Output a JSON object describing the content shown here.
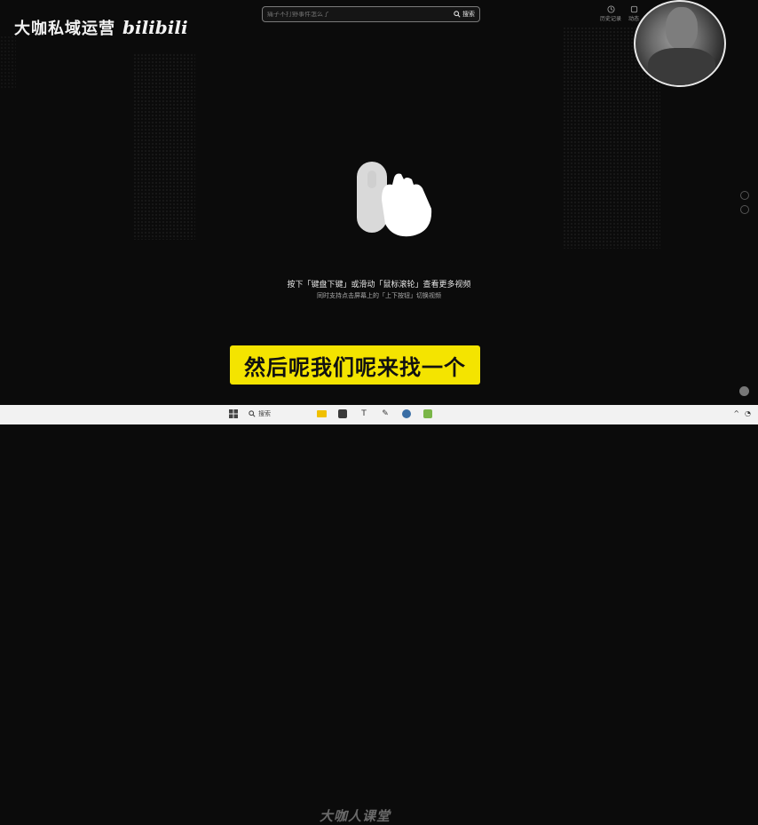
{
  "header": {
    "brand_text": "大咖私域运营",
    "logo_text": "bilibili"
  },
  "search": {
    "placeholder": "痛子不打野事件怎么了",
    "button_label": "搜索"
  },
  "top_icons": [
    {
      "icon": "history-icon",
      "label": "历史记录"
    },
    {
      "icon": "dynamic-icon",
      "label": "动态"
    }
  ],
  "main": {
    "hint_primary": "按下「键盘下键」或滑动「鼠标滚轮」查看更多视频",
    "hint_secondary": "同时支持点击屏幕上的「上下按钮」切换视频"
  },
  "subtitle": "然后呢我们呢来找一个",
  "taskbar": {
    "search_label": "搜索",
    "watermark": "大咖人课堂"
  },
  "colors": {
    "subtitle_bg": "#f4e400",
    "background": "#0b0b0b"
  }
}
